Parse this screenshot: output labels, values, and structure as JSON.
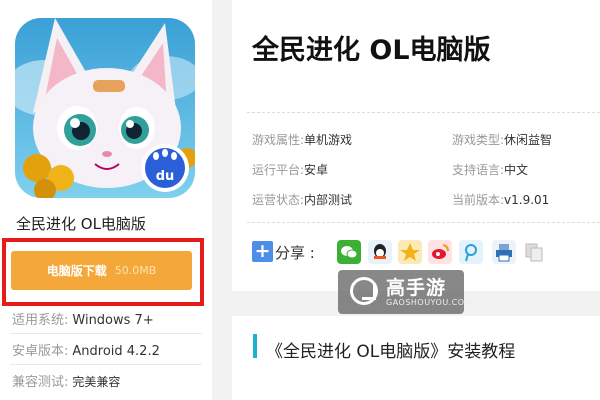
{
  "app": {
    "name": "全民进化 OL电脑版",
    "download": {
      "label": "电脑版下载",
      "size": "50.0MB"
    },
    "specs": [
      {
        "key": "适用系统:",
        "value": "Windows 7+"
      },
      {
        "key": "安卓版本:",
        "value": "Android 4.2.2"
      },
      {
        "key": "兼容测试:",
        "value": "完美兼容"
      }
    ],
    "icon": "cat-character-app-icon",
    "badge_text": "du"
  },
  "detail": {
    "title": "全民进化 OL电脑版",
    "attrs": [
      {
        "key": "游戏属性:",
        "value": "单机游戏"
      },
      {
        "key": "游戏类型:",
        "value": "休闲益智"
      },
      {
        "key": "运行平台:",
        "value": "安卓"
      },
      {
        "key": "支持语言:",
        "value": "中文"
      },
      {
        "key": "运营状态:",
        "value": "内部测试"
      },
      {
        "key": "当前版本:",
        "value": "v1.9.01"
      }
    ],
    "share": {
      "label": "分享 :",
      "icons": [
        "wechat-icon",
        "qq-icon",
        "qzone-icon",
        "weibo-icon",
        "tencent-weibo-icon",
        "print-icon",
        "copy-icon"
      ]
    }
  },
  "section": {
    "title": "《全民进化 OL电脑版》安装教程"
  },
  "watermark": {
    "main": "高手游",
    "sub": "GAOSHOUYOU.COM"
  },
  "colors": {
    "download": "#f5a83a",
    "highlight_border": "#e81b1b",
    "accent": "#1ab2cc"
  }
}
